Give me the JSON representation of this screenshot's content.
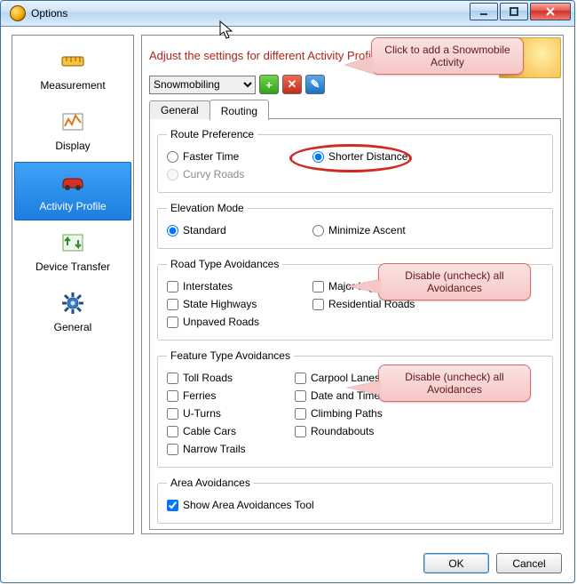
{
  "window": {
    "title": "Options"
  },
  "sidebar": {
    "items": [
      {
        "label": "Measurement"
      },
      {
        "label": "Display"
      },
      {
        "label": "Activity Profile"
      },
      {
        "label": "Device Transfer"
      },
      {
        "label": "General"
      }
    ],
    "selected_index": 2
  },
  "header": {
    "text": "Adjust the settings for different Activity Profiles"
  },
  "activity_select": {
    "value": "Snowmobiling",
    "options": [
      "Snowmobiling"
    ]
  },
  "toolbar_icons": {
    "add": "+",
    "delete": "✕",
    "edit": "✎"
  },
  "tabs": [
    {
      "label": "General"
    },
    {
      "label": "Routing"
    }
  ],
  "active_tab_index": 1,
  "groups": {
    "route_pref": {
      "legend": "Route Preference",
      "options": {
        "faster_time": "Faster Time",
        "shorter_distance": "Shorter Distance",
        "curvy_roads": "Curvy Roads"
      },
      "selected": "shorter_distance",
      "disabled": [
        "curvy_roads"
      ]
    },
    "elevation": {
      "legend": "Elevation Mode",
      "options": {
        "standard": "Standard",
        "minimize": "Minimize Ascent"
      },
      "selected": "standard"
    },
    "road_avoid": {
      "legend": "Road Type Avoidances",
      "items": [
        "Interstates",
        "Major Highways",
        "State Highways",
        "Residential Roads",
        "Unpaved Roads"
      ],
      "checked": []
    },
    "feature_avoid": {
      "legend": "Feature Type Avoidances",
      "items": [
        "Toll Roads",
        "Carpool Lanes",
        "Ferries",
        "Date and Time Closures",
        "U-Turns",
        "Climbing Paths",
        "Cable Cars",
        "Roundabouts",
        "Narrow Trails"
      ],
      "checked": []
    },
    "area_avoid": {
      "legend": "Area Avoidances",
      "items": [
        "Show Area Avoidances Tool"
      ],
      "checked": [
        "Show Area Avoidances Tool"
      ]
    }
  },
  "callouts": {
    "c1": "Click to add a Snowmobile Activity",
    "c2": "Disable (uncheck) all Avoidances",
    "c3": "Disable (uncheck) all Avoidances"
  },
  "buttons": {
    "ok": "OK",
    "cancel": "Cancel"
  }
}
